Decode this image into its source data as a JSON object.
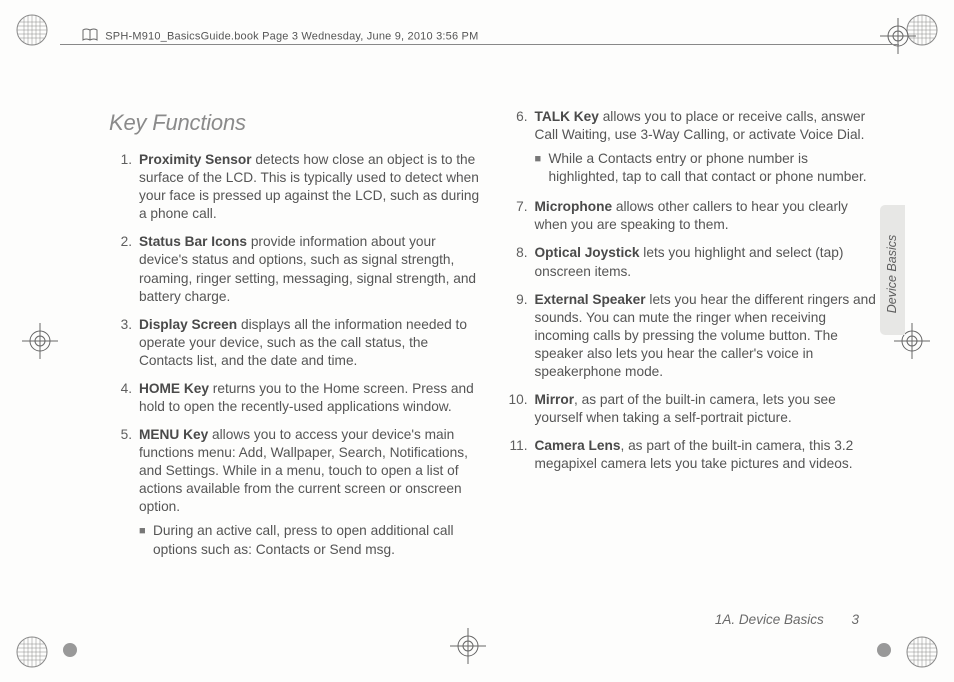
{
  "header_run": "SPH-M910_BasicsGuide.book  Page 3  Wednesday, June 9, 2010  3:56 PM",
  "section_title": "Key Functions",
  "left_items": [
    {
      "num": "1.",
      "term": "Proximity Sensor",
      "text": " detects how close an object is to the surface of the LCD. This is typically used to detect when your face is pressed up against the LCD, such as during a phone call."
    },
    {
      "num": "2.",
      "term": "Status Bar Icons",
      "text": " provide information about your device's status and options, such as signal strength, roaming, ringer setting, messaging, signal strength, and battery charge."
    },
    {
      "num": "3.",
      "term": "Display Screen",
      "text": " displays all the information needed to operate your device, such as the call status, the Contacts list, and the date and time."
    },
    {
      "num": "4.",
      "term": "HOME Key",
      "text": " returns you to the Home screen. Press and hold to open the recently-used applications window."
    },
    {
      "num": "5.",
      "term": "MENU Key",
      "text": " allows you to access your device's main functions menu: Add, Wallpaper, Search, Notifications, and Settings. While in a menu, touch to open a list of actions available from the current screen or onscreen option.",
      "sub": "During an active call, press to open additional call options such as: Contacts or Send msg."
    }
  ],
  "right_items": [
    {
      "num": "6.",
      "term": "TALK Key",
      "text": " allows you to place or receive calls, answer Call Waiting, use 3-Way Calling, or activate Voice Dial.",
      "sub": "While a Contacts entry or phone number is highlighted, tap to call that contact or phone number."
    },
    {
      "num": "7.",
      "term": "Microphone",
      "text": " allows other callers to hear you clearly when you are speaking to them."
    },
    {
      "num": "8.",
      "term": "Optical Joystick",
      "text": " lets you highlight and select (tap) onscreen items."
    },
    {
      "num": "9.",
      "term": "External Speaker",
      "text": " lets you hear the different ringers and sounds. You can mute the ringer when receiving incoming calls by pressing the volume button. The speaker also lets you hear the caller's voice in speakerphone mode."
    },
    {
      "num": "10.",
      "term": "Mirror",
      "text": ", as part of the built-in camera, lets you see yourself when taking a self-portrait picture."
    },
    {
      "num": "11.",
      "term": "Camera Lens",
      "text": ", as part of the built-in camera, this 3.2 megapixel camera lets you take pictures and videos."
    }
  ],
  "side_tab": "Device Basics",
  "footer_section": "1A. Device Basics",
  "footer_page": "3"
}
